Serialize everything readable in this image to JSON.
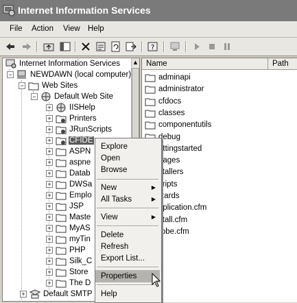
{
  "window": {
    "title": "Internet Information Services"
  },
  "menu": [
    "File",
    "Action",
    "View",
    "Help"
  ],
  "tree": {
    "root": "Internet Information Services",
    "computer": "NEWDAWN (local computer)",
    "web_sites": "Web Sites",
    "default_site": "Default Web Site",
    "children": [
      "IISHelp",
      "Printers",
      "JRunScripts",
      "CFIDE",
      "ASPN",
      "aspne",
      "Datab",
      "DWSa",
      "Emplo",
      "JSP",
      "Maste",
      "MyAS",
      "myTin",
      "PHP",
      "Silk_C",
      "Store",
      "The D"
    ],
    "smtp": "Default SMTP"
  },
  "list": {
    "columns": [
      "Name",
      "Path"
    ],
    "items": [
      "adminapi",
      "administrator",
      "cfdocs",
      "classes",
      "componentutils",
      "debug",
      "ettingstarted",
      "nages",
      "stallers",
      "cripts",
      "izards",
      "pplication.cfm",
      "stall.cfm",
      "robe.cfm"
    ]
  },
  "context_menu": {
    "items": [
      "Explore",
      "Open",
      "Browse",
      "New",
      "All Tasks",
      "View",
      "Delete",
      "Refresh",
      "Export List...",
      "Properties",
      "Help"
    ]
  }
}
